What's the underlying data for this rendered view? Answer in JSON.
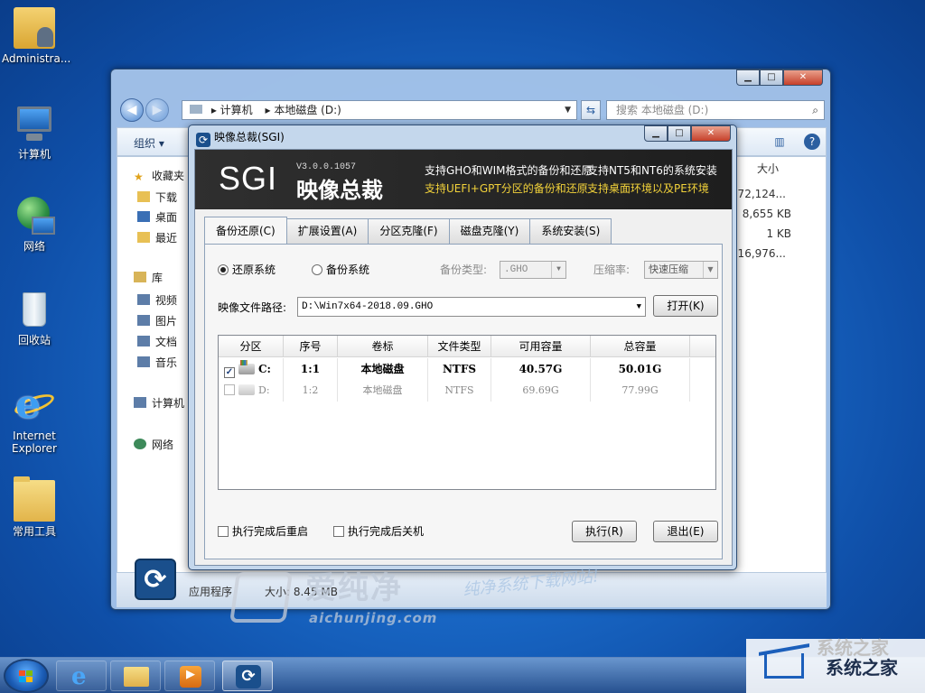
{
  "desktop": {
    "icons": [
      {
        "label": "Administra..."
      },
      {
        "label": "计算机"
      },
      {
        "label": "网络"
      },
      {
        "label": "回收站"
      },
      {
        "label": "Internet Explorer"
      },
      {
        "label": "常用工具"
      }
    ]
  },
  "explorer": {
    "address": [
      "计算机",
      "本地磁盘 (D:)"
    ],
    "search_placeholder": "搜索 本地磁盘 (D:)",
    "organize_label": "组织 ▾",
    "nav": {
      "favorites": "收藏夹",
      "downloads": "下载",
      "desktop": "桌面",
      "recent": "最近",
      "libraries": "库",
      "videos": "视频",
      "pictures": "图片",
      "documents": "文档",
      "music": "音乐",
      "computer": "计算机",
      "network": "网络"
    },
    "right_col": {
      "header": "大小",
      "sizes": [
        "172,124...",
        "8,655 KB",
        "1 KB",
        "416,976..."
      ]
    },
    "status": {
      "type_label": "应用程序",
      "size_label": "大小: 8.45 MB"
    }
  },
  "dialog": {
    "title": "映像总裁(SGI)",
    "banner": {
      "logo": "SGI",
      "version": "V3.0.0.1057",
      "brand": "映像总裁",
      "features": [
        {
          "text": "支持GHO和WIM格式的备份和还原",
          "color": "#ffffff"
        },
        {
          "text": "支持NT5和NT6的系统安装",
          "color": "#ffffff"
        },
        {
          "text": "支持UEFI+GPT分区的备份和还原",
          "color": "#f2d23a"
        },
        {
          "text": "支持桌面环境以及PE环境",
          "color": "#f2d23a"
        }
      ]
    },
    "tabs": [
      "备份还原(C)",
      "扩展设置(A)",
      "分区克隆(F)",
      "磁盘克隆(Y)",
      "系统安装(S)"
    ],
    "active_tab": 0,
    "mode": {
      "restore_label": "还原系统",
      "backup_label": "备份系统",
      "selected": "restore"
    },
    "backup_type": {
      "label": "备份类型:",
      "value": ".GHO"
    },
    "compression": {
      "label": "压缩率:",
      "value": "快速压缩"
    },
    "image_path": {
      "label": "映像文件路径:",
      "value": "D:\\Win7x64-2018.09.GHO"
    },
    "open_button": "打开(K)",
    "table": {
      "columns": [
        "分区",
        "序号",
        "卷标",
        "文件类型",
        "可用容量",
        "总容量"
      ],
      "rows": [
        {
          "drive": "C:",
          "index": "1:1",
          "label": "本地磁盘",
          "fs": "NTFS",
          "free": "40.57G",
          "total": "50.01G",
          "checked": true
        },
        {
          "drive": "D:",
          "index": "1:2",
          "label": "本地磁盘",
          "fs": "NTFS",
          "free": "69.69G",
          "total": "77.99G",
          "checked": false
        }
      ]
    },
    "reboot_after": "执行完成后重启",
    "shutdown_after": "执行完成后关机",
    "execute_button": "执行(R)",
    "exit_button": "退出(E)"
  },
  "watermarks": {
    "site_cn": "爱纯净",
    "site_en": "aichunjing.com",
    "slogan": "纯净系统下载网站!",
    "brand2_top": "系统之家",
    "brand2": "系统之家"
  }
}
